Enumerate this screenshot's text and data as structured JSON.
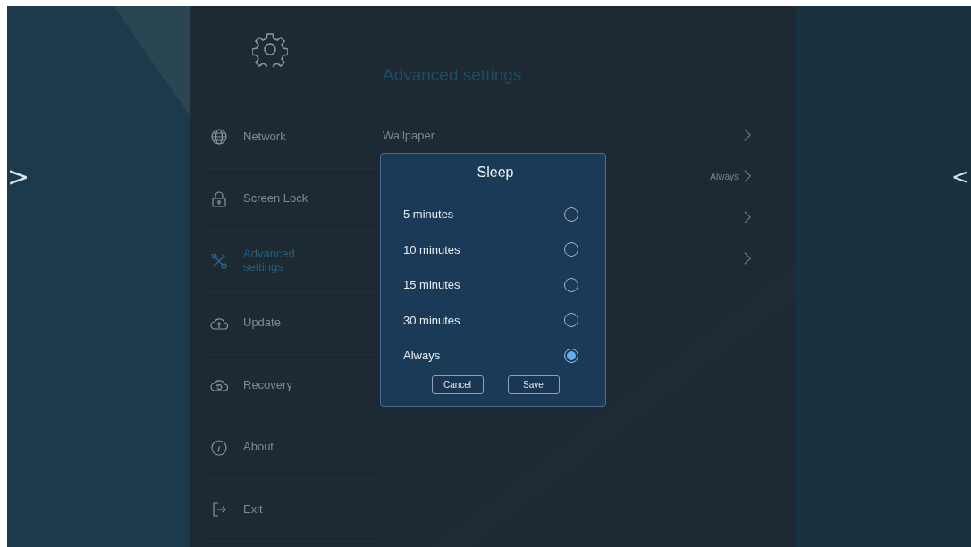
{
  "page_nav": {
    "previous": ">",
    "next": "<"
  },
  "sidebar": {
    "items": [
      {
        "label": "Network",
        "selected": false
      },
      {
        "label": "Screen Lock",
        "selected": false
      },
      {
        "label": "Advanced settings",
        "selected": true
      },
      {
        "label": "Update",
        "selected": false
      },
      {
        "label": "Recovery",
        "selected": false
      },
      {
        "label": "About",
        "selected": false
      },
      {
        "label": "Exit",
        "selected": false
      }
    ]
  },
  "main": {
    "title": "Advanced settings",
    "rows": [
      {
        "label": "Wallpaper"
      },
      {
        "value": "Always"
      },
      {},
      {}
    ]
  },
  "dialog": {
    "title": "Sleep",
    "options": [
      {
        "label": "5 minutes",
        "selected": false
      },
      {
        "label": "10 minutes",
        "selected": false
      },
      {
        "label": "15 minutes",
        "selected": false
      },
      {
        "label": "30 minutes",
        "selected": false
      },
      {
        "label": "Always",
        "selected": true
      }
    ],
    "buttons": [
      "Cancel",
      "Save"
    ]
  }
}
